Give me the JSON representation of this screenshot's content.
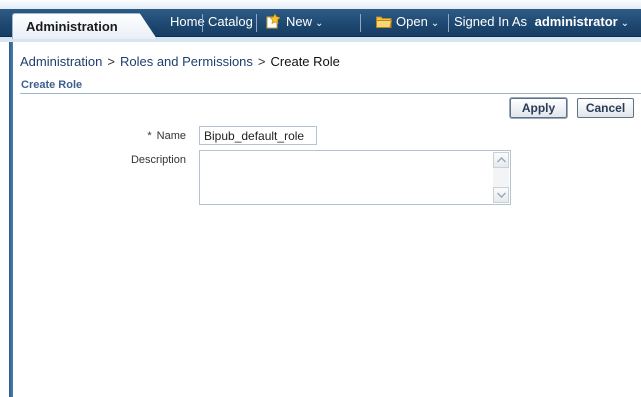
{
  "header": {
    "active_tab": "Administration",
    "nav": {
      "home": "Home",
      "catalog": "Catalog",
      "new": "New",
      "open": "Open",
      "signed_in_prefix": "Signed In As",
      "username": "administrator"
    }
  },
  "breadcrumb": {
    "items": [
      "Administration",
      "Roles and Permissions",
      "Create Role"
    ],
    "separator": ">"
  },
  "section": {
    "title": "Create Role"
  },
  "actions": {
    "apply_label": "Apply",
    "cancel_label": "Cancel"
  },
  "form": {
    "name": {
      "required_marker": "*",
      "label": "Name",
      "value": "Bipub_default_role"
    },
    "description": {
      "label": "Description",
      "value": ""
    }
  },
  "icons": {
    "new": "new-document-icon",
    "open": "folder-icon",
    "dropdown": "chevron-down-icon"
  },
  "colors": {
    "nav_bar": "#1f4a73",
    "link": "#1d3f6e",
    "section_title": "#3d5f8f"
  }
}
